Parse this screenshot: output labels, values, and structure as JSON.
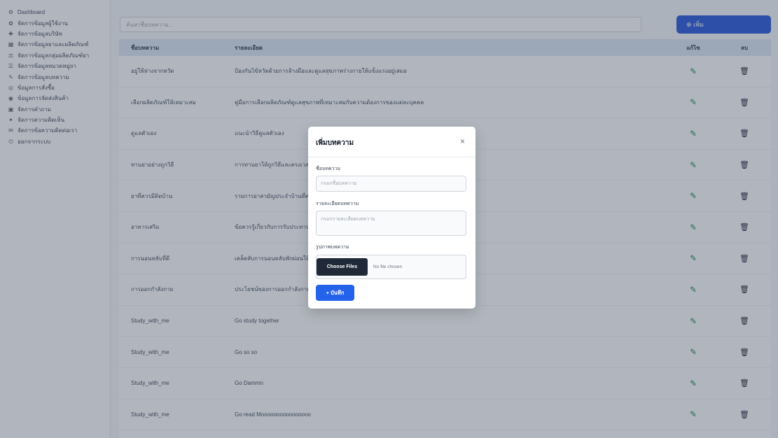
{
  "sidebar": {
    "items": [
      {
        "icon": "⚙",
        "icon_name": "gauge-icon",
        "label": "Dashboard"
      },
      {
        "icon": "✿",
        "icon_name": "flower-icon",
        "label": "จัดการข้อมูลผู้ใช้งาน"
      },
      {
        "icon": "✚",
        "icon_name": "plus-icon",
        "label": "จัดการข้อมูลบริษัท"
      },
      {
        "icon": "▦",
        "icon_name": "grid-icon",
        "label": "จัดการข้อมูลยาและผลิตภัณฑ์"
      },
      {
        "icon": "⚖",
        "icon_name": "scale-icon",
        "label": "จัดการข้อมูลกลุ่มผลิตภัณฑ์ยา"
      },
      {
        "icon": "☰",
        "icon_name": "list-icon",
        "label": "จัดการข้อมูลหมวดหมู่ยา"
      },
      {
        "icon": "✎",
        "icon_name": "pen-icon",
        "label": "จัดการข้อมูลบทความ"
      },
      {
        "icon": "◎",
        "icon_name": "target-icon",
        "label": "ข้อมูลการสั่งซื้อ"
      },
      {
        "icon": "◉",
        "icon_name": "dot-circle-icon",
        "label": "ข้อมูลการจัดส่งสินค้า"
      },
      {
        "icon": "▣",
        "icon_name": "box-icon",
        "label": "จัดการคำถาม"
      },
      {
        "icon": "✦",
        "icon_name": "star-icon",
        "label": "จัดการความคิดเห็น"
      },
      {
        "icon": "✉",
        "icon_name": "mail-icon",
        "label": "จัดการข้อความติดต่อเรา"
      },
      {
        "icon": "⏻",
        "icon_name": "logout-icon",
        "label": "ออกจากระบบ"
      }
    ]
  },
  "toolbar": {
    "search_placeholder": "ค้นหาชื่อบทความ...",
    "add_button_label": "⊕ เพิ่ม"
  },
  "table": {
    "columns": {
      "name": "ชื่อบทความ",
      "description": "รายละเอียด",
      "edit": "แก้ไข",
      "delete": "ลบ"
    },
    "rows": [
      {
        "name": "อยู่ให้ห่างจากหวัด",
        "description": "ป้องกันไข้หวัดด้วยการล้างมือและดูแลสุขภาพร่างกายให้แข็งแรงอยู่เสมอ"
      },
      {
        "name": "เลือกผลิตภัณฑ์ให้เหมาะสม",
        "description": "คู่มือการเลือกผลิตภัณฑ์ดูแลสุขภาพที่เหมาะสมกับความต้องการของแต่ละบุคคล"
      },
      {
        "name": "ดูแลตัวเอง",
        "description": "แนะนำวิธีดูแลตัวเอง"
      },
      {
        "name": "ทานยาอย่างถูกวิธี",
        "description": "การทานยาให้ถูกวิธีและตรงเวลาช่วยให้การรักษาได้ผลดีที่สุด"
      },
      {
        "name": "ยาที่ควรมีติดบ้าน",
        "description": "รายการยาสามัญประจำบ้านที่ควรมีไว้ใช้ยามฉุกเฉิน"
      },
      {
        "name": "อาหารเสริม",
        "description": "ข้อควรรู้เกี่ยวกับการรับประทานอาหารเสริมอย่างปลอดภัย"
      },
      {
        "name": "การนอนหลับที่ดี",
        "description": "เคล็ดลับการนอนหลับพักผ่อนให้เพียงพอเพื่อสุขภาพที่ดี"
      },
      {
        "name": "การออกกำลังกาย",
        "description": "ประโยชน์ของการออกกำลังกายอย่างสม่ำเสมอ"
      },
      {
        "name": "Study_with_me",
        "description": "Go study together"
      },
      {
        "name": "Study_with_me",
        "description": "Go so so"
      },
      {
        "name": "Study_with_me",
        "description": "Go Dammn"
      },
      {
        "name": "Study_with_me",
        "description": "Go read Moooooooooooooooo"
      }
    ]
  },
  "modal": {
    "title": "เพิ่มบทความ",
    "close_icon": "×",
    "name_label": "ชื่อบทความ",
    "name_placeholder": "กรอกชื่อบทความ",
    "desc_label": "รายละเอียดบทความ",
    "desc_placeholder": "กรอกรายละเอียดบทความ",
    "image_label": "รูปภาพบทความ",
    "choose_button_label": "Choose Files",
    "file_status": "No file chosen",
    "submit_label": "+ บันทึก"
  },
  "colors": {
    "primary": "#1d4ed8",
    "header_bg": "#dbe6f5",
    "edit_icon": "#15803d",
    "delete_icon": "#111827"
  }
}
